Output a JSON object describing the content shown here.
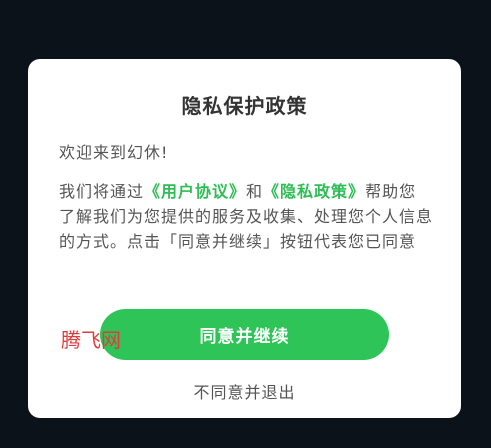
{
  "dialog": {
    "title": "隐私保护政策",
    "greeting": "欢迎来到幻休!",
    "body": {
      "part1": "我们将通过",
      "user_agreement_link": "《用户协议》",
      "and": "和",
      "privacy_policy_link": "《隐私政策》",
      "part2": "帮助您了解我们为您提供的服务及收集、处理您个人信息的方式。点击「同意并继续」按钮代表您已同意"
    },
    "agree_button_label": "同意并继续",
    "decline_label": "不同意并退出"
  },
  "watermark": "腾飞网",
  "colors": {
    "accent": "#2ec458",
    "background": "#0b121a",
    "watermark": "#e23b3b"
  }
}
